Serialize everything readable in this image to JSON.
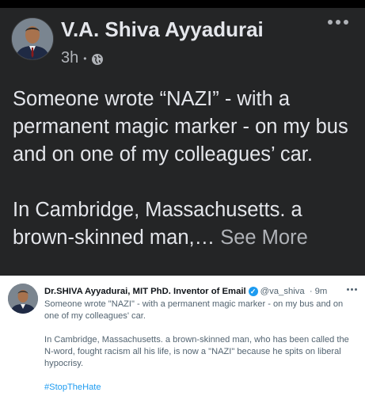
{
  "post": {
    "author": "V.A. Shiva Ayyadurai",
    "time": "3h",
    "separator": "•",
    "text_para1": "Someone wrote “NAZI” - with a permanent magic marker - on my bus and on one of my colleagues’ car.",
    "text_para2": "In Cambridge, Massachusetts. a brown-skinned man,…",
    "see_more": "See More"
  },
  "tweet": {
    "name": "Dr.SHIVA Ayyadurai, MIT PhD. Inventor of Email",
    "handle": "@va_shiva",
    "time": "9m",
    "dot": "·",
    "para1": "Someone wrote \"NAZI\" - with a permanent magic marker - on my bus and on one of my colleagues' car.",
    "para2": "In Cambridge, Massachusetts. a brown-skinned man, who has been called the N-word, fought racism all his life, is now a \"NAZI\" because he spits on liberal hypocrisy.",
    "hashtag": "#StopTheHate"
  },
  "icons": [
    "globe-icon",
    "more-options-icon",
    "verified-badge-icon"
  ]
}
